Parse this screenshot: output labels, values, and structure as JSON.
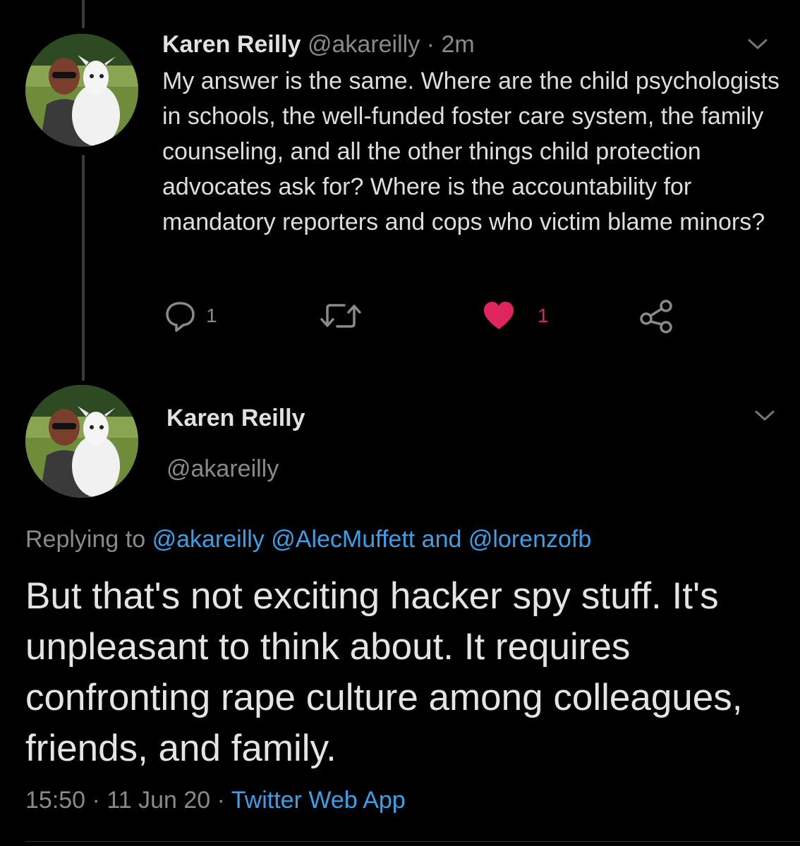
{
  "tweet1": {
    "author_name": "Karen Reilly",
    "handle": "@akareilly",
    "separator": "·",
    "time_ago": "2m",
    "body": "My answer is the same. Where are the child psychologists in schools, the well-funded foster care system, the family counseling, and all the other things child protection advocates ask for? Where is the accountability for mandatory reporters and cops who victim blame minors?",
    "reply_count": "1",
    "like_count": "1",
    "liked": true,
    "icons": [
      "reply-icon",
      "retweet-icon",
      "heart-icon",
      "share-icon",
      "chevron-down-icon"
    ]
  },
  "tweet2": {
    "author_name": "Karen Reilly",
    "handle": "@akareilly",
    "replying_prefix": "Replying to",
    "mention1": "@akareilly",
    "mention2": "@AlecMuffett",
    "and_word": "and",
    "mention3": "@lorenzofb",
    "body": "But that's not exciting hacker spy stuff. It's unpleasant to think about. It requires confronting rape culture among colleagues, friends, and family.",
    "time": "15:50",
    "dot": "·",
    "date": "11 Jun 20",
    "source": "Twitter Web App"
  },
  "colors": {
    "background": "#000000",
    "link": "#3aa0e8",
    "like": "#e0245e",
    "muted": "#8a8a8a"
  }
}
